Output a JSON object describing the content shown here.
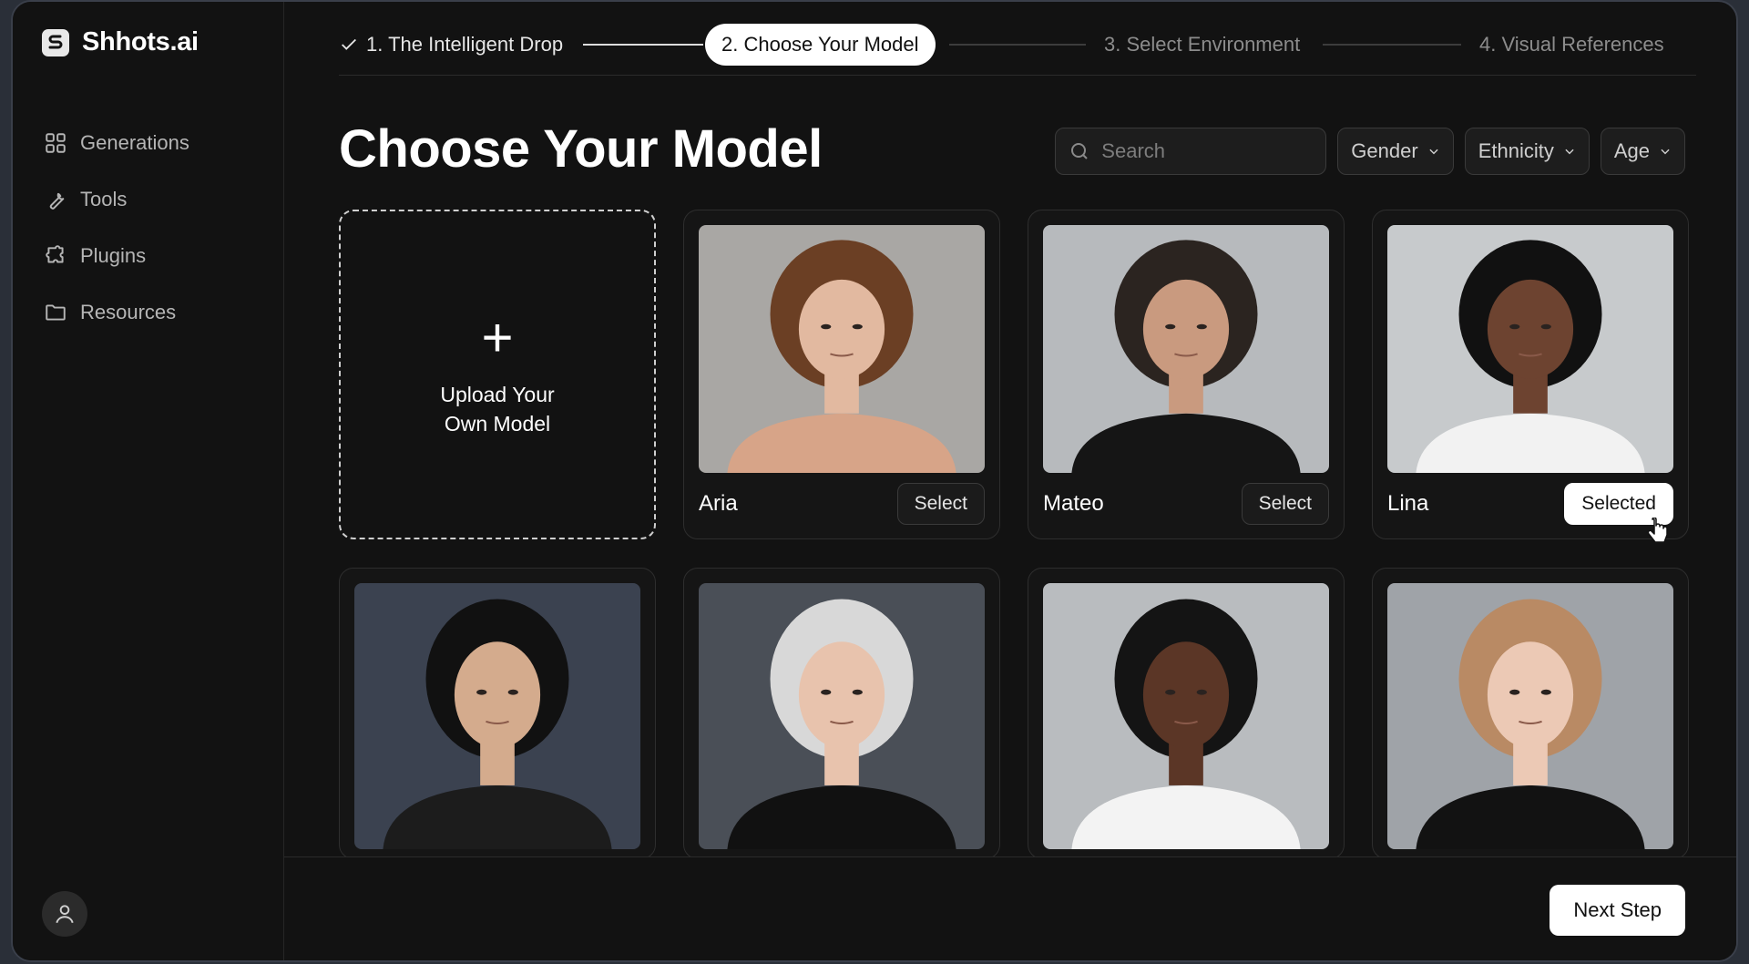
{
  "app": {
    "name": "Shhots.ai"
  },
  "sidebar": {
    "items": [
      {
        "label": "Generations",
        "icon": "grid-icon"
      },
      {
        "label": "Tools",
        "icon": "wrench-icon"
      },
      {
        "label": "Plugins",
        "icon": "puzzle-icon"
      },
      {
        "label": "Resources",
        "icon": "folder-icon"
      }
    ],
    "profile_icon": "user-icon"
  },
  "stepper": {
    "steps": [
      {
        "label": "1. The Intelligent Drop",
        "state": "done"
      },
      {
        "label": "2. Choose Your Model",
        "state": "active"
      },
      {
        "label": "3. Select Environment",
        "state": "pending"
      },
      {
        "label": "4. Visual References",
        "state": "pending"
      }
    ]
  },
  "main": {
    "title": "Choose Your Model",
    "search": {
      "placeholder": "Search",
      "value": ""
    },
    "filters": [
      {
        "label": "Gender"
      },
      {
        "label": "Ethnicity"
      },
      {
        "label": "Age"
      }
    ],
    "upload": {
      "line1": "Upload Your",
      "line2": "Own Model"
    },
    "models": [
      {
        "name": "Aria",
        "button": "Select",
        "selected": false,
        "bg": "#a9a7a4",
        "hair": "#6b3f24",
        "skin": "#e2b9a0",
        "top": "#d7a488"
      },
      {
        "name": "Mateo",
        "button": "Select",
        "selected": false,
        "bg": "#b7babd",
        "hair": "#2b2420",
        "skin": "#c99a7f",
        "top": "#151515"
      },
      {
        "name": "Lina",
        "button": "Selected",
        "selected": true,
        "bg": "#c7cacc",
        "hair": "#111111",
        "skin": "#6d4330",
        "top": "#f2f2f2"
      },
      {
        "name": "",
        "bg": "#3b4250",
        "hair": "#111111",
        "skin": "#d4ab8d",
        "top": "#1c1c1c"
      },
      {
        "name": "",
        "bg": "#4a4f57",
        "hair": "#d8d8d8",
        "skin": "#e8c3ad",
        "top": "#111111"
      },
      {
        "name": "",
        "bg": "#b9bcbf",
        "hair": "#141414",
        "skin": "#5b3626",
        "top": "#f3f3f3"
      },
      {
        "name": "",
        "bg": "#9fa3a8",
        "hair": "#b98a64",
        "skin": "#ecc9b5",
        "top": "#121212"
      }
    ],
    "next_button": "Next Step"
  }
}
